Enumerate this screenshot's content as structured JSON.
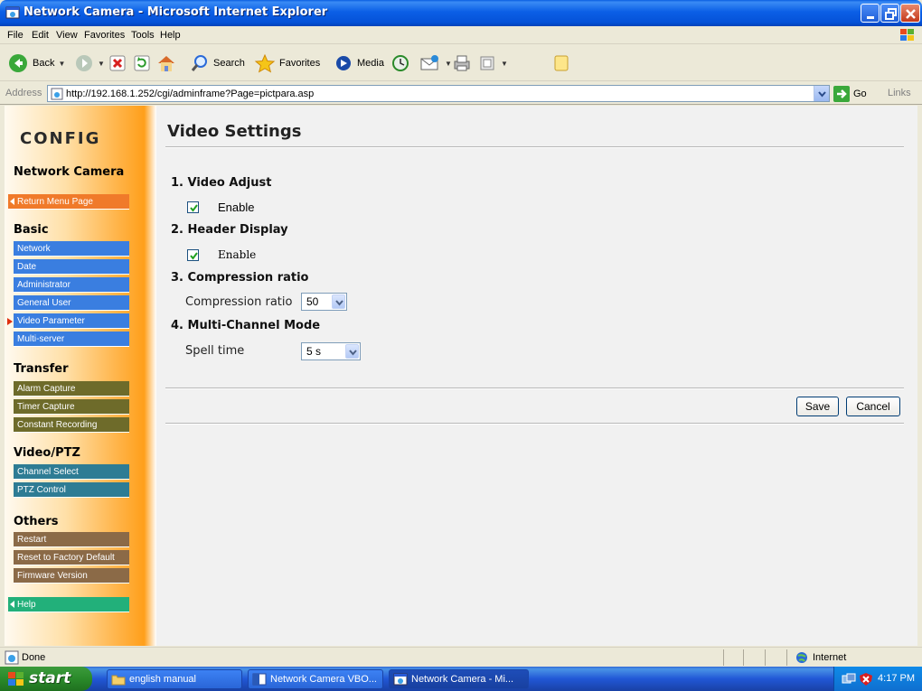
{
  "window": {
    "title": "Network Camera - Microsoft Internet Explorer"
  },
  "menu": [
    "File",
    "Edit",
    "View",
    "Favorites",
    "Tools",
    "Help"
  ],
  "toolbar": {
    "back_label": "Back",
    "search_label": "Search",
    "favorites_label": "Favorites",
    "media_label": "Media"
  },
  "address": {
    "label": "Address",
    "url": "http://192.168.1.252/cgi/adminframe?Page=pictpara.asp",
    "go_label": "Go",
    "links_label": "Links"
  },
  "sidebar": {
    "title": "CONFIG",
    "product": "Network Camera",
    "return_label": "Return Menu Page",
    "basic": {
      "header": "Basic",
      "items": [
        "Network",
        "Date",
        "Administrator",
        "General User",
        "Video Parameter",
        "Multi-server"
      ],
      "active": "Video Parameter"
    },
    "transfer": {
      "header": "Transfer",
      "items": [
        "Alarm Capture",
        "Timer Capture",
        "Constant Recording"
      ]
    },
    "video_ptz": {
      "header": "Video/PTZ",
      "items": [
        "Channel Select",
        "PTZ Control"
      ]
    },
    "others": {
      "header": "Others",
      "items": [
        "Restart",
        "Reset to Factory Default",
        "Firmware Version"
      ]
    },
    "help_label": "Help"
  },
  "main": {
    "title": "Video Settings",
    "sections": [
      {
        "heading": "1. Video Adjust",
        "checkbox_label": "Enable",
        "checked": true
      },
      {
        "heading": "2. Header Display",
        "checkbox_label": "Enable",
        "checked": true
      },
      {
        "heading": "3. Compression ratio",
        "field_label": "Compression ratio",
        "value": "50"
      },
      {
        "heading": "4. Multi-Channel Mode",
        "field_label": "Spell time",
        "value": "5 s"
      }
    ],
    "save_label": "Save",
    "cancel_label": "Cancel"
  },
  "status": {
    "text": "Done",
    "zone": "Internet"
  },
  "taskbar": {
    "start_label": "start",
    "tasks": [
      "english manual",
      "Network Camera VBO...",
      "Network Camera - Mi..."
    ],
    "clock": "4:17 PM"
  },
  "colors": {
    "title_bar": "#0b5fe6",
    "sidebar_blue": "#3a7ee0",
    "sidebar_olive": "#6e6b2a",
    "sidebar_teal": "#2e7c94",
    "sidebar_brown": "#8b6a47",
    "sidebar_orange": "#f07a2a",
    "sidebar_green": "#22b07a"
  }
}
